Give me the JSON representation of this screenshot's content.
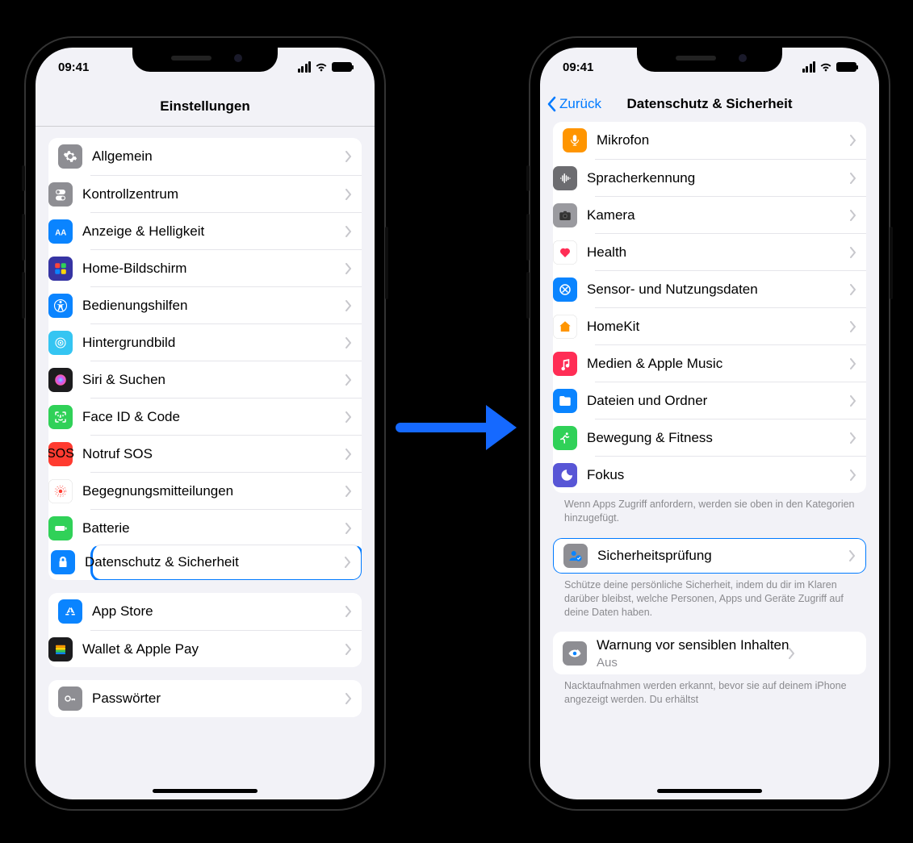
{
  "status": {
    "time": "09:41"
  },
  "left": {
    "title": "Einstellungen",
    "items": [
      {
        "id": "general",
        "label": "Allgemein",
        "iconBg": "#8e8e93"
      },
      {
        "id": "control-center",
        "label": "Kontrollzentrum",
        "iconBg": "#8e8e93"
      },
      {
        "id": "display",
        "label": "Anzeige & Helligkeit",
        "iconBg": "#0a84ff"
      },
      {
        "id": "home-screen",
        "label": "Home-Bildschirm",
        "iconBg": "#3634a3"
      },
      {
        "id": "accessibility",
        "label": "Bedienungshilfen",
        "iconBg": "#0a84ff"
      },
      {
        "id": "wallpaper",
        "label": "Hintergrundbild",
        "iconBg": "#35c5f2"
      },
      {
        "id": "siri",
        "label": "Siri & Suchen",
        "iconBg": "#1c1c1e"
      },
      {
        "id": "faceid",
        "label": "Face ID & Code",
        "iconBg": "#30d158"
      },
      {
        "id": "sos",
        "label": "Notruf SOS",
        "iconBg": "#ff3b30"
      },
      {
        "id": "exposure",
        "label": "Begegnungsmitteilungen",
        "iconBg": "#ffffff"
      },
      {
        "id": "battery",
        "label": "Batterie",
        "iconBg": "#30d158"
      },
      {
        "id": "privacy",
        "label": "Datenschutz & Sicherheit",
        "iconBg": "#0a84ff",
        "highlight": true
      }
    ],
    "group2": [
      {
        "id": "appstore",
        "label": "App Store",
        "iconBg": "#0a84ff"
      },
      {
        "id": "wallet",
        "label": "Wallet & Apple Pay",
        "iconBg": "#1c1c1e"
      }
    ],
    "group3": [
      {
        "id": "passwords",
        "label": "Passwörter",
        "iconBg": "#8e8e93"
      }
    ]
  },
  "right": {
    "back": "Zurück",
    "title": "Datenschutz & Sicherheit",
    "items": [
      {
        "id": "microphone",
        "label": "Mikrofon",
        "iconBg": "#ff9500"
      },
      {
        "id": "speech",
        "label": "Spracherkennung",
        "iconBg": "#6c6c70"
      },
      {
        "id": "camera",
        "label": "Kamera",
        "iconBg": "#9a9a9f"
      },
      {
        "id": "health",
        "label": "Health",
        "iconBg": "#ffffff"
      },
      {
        "id": "sensor",
        "label": "Sensor- und Nutzungsdaten",
        "iconBg": "#0a84ff"
      },
      {
        "id": "homekit",
        "label": "HomeKit",
        "iconBg": "#ffffff"
      },
      {
        "id": "media",
        "label": "Medien & Apple Music",
        "iconBg": "#ff2d55"
      },
      {
        "id": "files",
        "label": "Dateien und Ordner",
        "iconBg": "#0a84ff"
      },
      {
        "id": "motion",
        "label": "Bewegung & Fitness",
        "iconBg": "#30d158"
      },
      {
        "id": "focus",
        "label": "Fokus",
        "iconBg": "#5856d6"
      }
    ],
    "footer1": "Wenn Apps Zugriff anfordern, werden sie oben in den Kategorien hinzugefügt.",
    "safety": {
      "id": "safety-check",
      "label": "Sicherheitsprüfung",
      "highlight": true
    },
    "footer2": "Schütze deine persönliche Sicherheit, indem du dir im Klaren darüber bleibst, welche Personen, Apps und Geräte Zugriff auf deine Daten haben.",
    "sensitive": {
      "id": "sensitive-content",
      "label": "Warnung vor sensiblen Inhalten",
      "value": "Aus"
    },
    "footer3": "Nacktaufnahmen werden erkannt, bevor sie auf deinem iPhone angezeigt werden. Du erhältst"
  }
}
